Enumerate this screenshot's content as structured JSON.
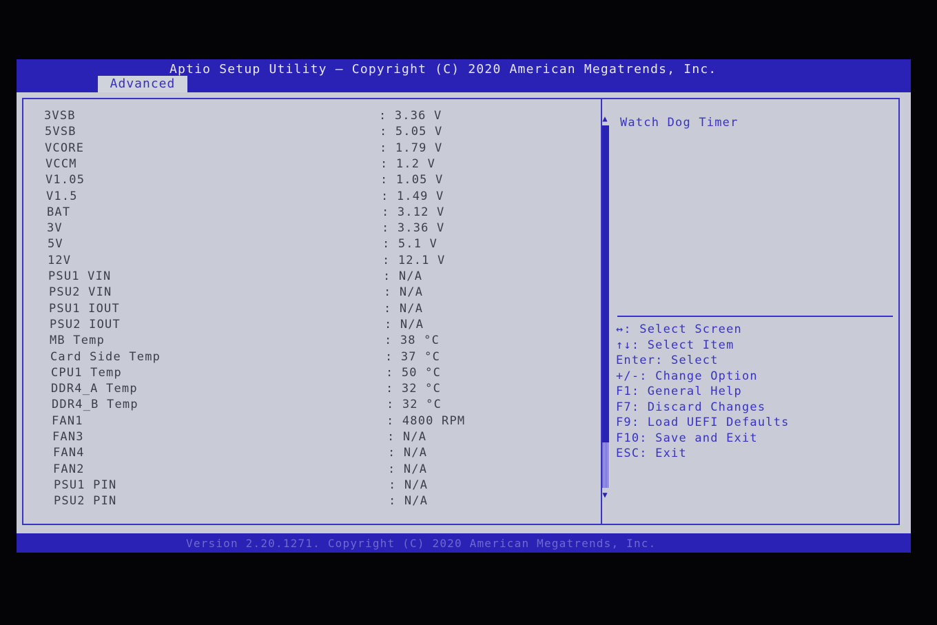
{
  "header": {
    "title": "Aptio Setup Utility – Copyright (C) 2020 American Megatrends, Inc.",
    "active_tab": "Advanced"
  },
  "sensors": [
    {
      "label": "3VSB",
      "value": ": 3.36 V"
    },
    {
      "label": "5VSB",
      "value": ": 5.05 V"
    },
    {
      "label": "VCORE",
      "value": ": 1.79 V"
    },
    {
      "label": "VCCM",
      "value": ": 1.2 V"
    },
    {
      "label": "V1.05",
      "value": ": 1.05 V"
    },
    {
      "label": "V1.5",
      "value": ": 1.49 V"
    },
    {
      "label": "BAT",
      "value": ": 3.12 V"
    },
    {
      "label": "3V",
      "value": ": 3.36 V"
    },
    {
      "label": "5V",
      "value": ": 5.1 V"
    },
    {
      "label": "12V",
      "value": ": 12.1 V"
    },
    {
      "label": "PSU1 VIN",
      "value": ": N/A"
    },
    {
      "label": "PSU2 VIN",
      "value": ": N/A"
    },
    {
      "label": "PSU1 IOUT",
      "value": ": N/A"
    },
    {
      "label": "PSU2 IOUT",
      "value": ": N/A"
    },
    {
      "label": "MB Temp",
      "value": ": 38 °C"
    },
    {
      "label": "Card Side Temp",
      "value": ": 37 °C"
    },
    {
      "label": "CPU1 Temp",
      "value": ": 50 °C"
    },
    {
      "label": "DDR4_A Temp",
      "value": ": 32 °C"
    },
    {
      "label": "DDR4_B Temp",
      "value": ": 32 °C"
    },
    {
      "label": "FAN1",
      "value": ": 4800 RPM"
    },
    {
      "label": "FAN3",
      "value": ": N/A"
    },
    {
      "label": "FAN4",
      "value": ": N/A"
    },
    {
      "label": "FAN2",
      "value": ": N/A"
    },
    {
      "label": "PSU1 PIN",
      "value": ": N/A"
    },
    {
      "label": "PSU2 PIN",
      "value": ": N/A"
    }
  ],
  "help": {
    "title": "Watch Dog Timer"
  },
  "keys": [
    "↔: Select Screen",
    "↑↓: Select Item",
    "Enter: Select",
    "+/-: Change Option",
    "F1: General Help",
    "F7: Discard Changes",
    "F9: Load UEFI Defaults",
    "F10: Save and Exit",
    "ESC: Exit"
  ],
  "footer": {
    "text": "Version 2.20.1271. Copyright (C) 2020 American Megatrends, Inc."
  },
  "scroll_position": 0.8,
  "colors": {
    "bar_blue": "#2a22b4",
    "panel_gray": "#c9ccd6",
    "text_dark": "#3c3f4a",
    "text_blue": "#3a32c4"
  }
}
